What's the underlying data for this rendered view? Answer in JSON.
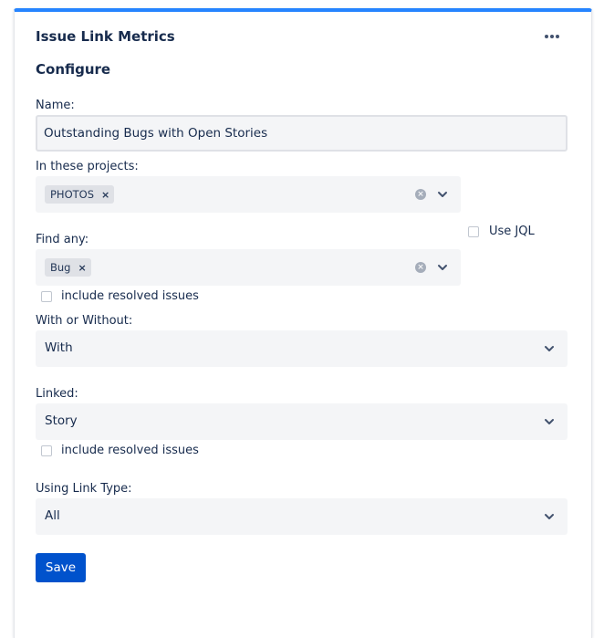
{
  "header": {
    "title": "Issue Link Metrics",
    "menu_icon": "more-icon"
  },
  "form": {
    "heading": "Configure",
    "name": {
      "label": "Name:",
      "value": "Outstanding Bugs with Open Stories"
    },
    "projects": {
      "label": "In these projects:",
      "tags": [
        "PHOTOS"
      ]
    },
    "use_jql": {
      "label": "Use JQL",
      "checked": false
    },
    "find_any": {
      "label": "Find any:",
      "tags": [
        "Bug"
      ]
    },
    "include_resolved_1": {
      "label": "include resolved issues",
      "checked": false
    },
    "with_or_without": {
      "label": "With or Without:",
      "value": "With"
    },
    "linked": {
      "label": "Linked:",
      "value": "Story"
    },
    "include_resolved_2": {
      "label": "include resolved issues",
      "checked": false
    },
    "link_type": {
      "label": "Using Link Type:",
      "value": "All"
    },
    "save_label": "Save"
  },
  "colors": {
    "accent": "#2684ff",
    "primary_button": "#0052cc",
    "field_bg": "#f4f5f7",
    "text": "#172b4d"
  }
}
